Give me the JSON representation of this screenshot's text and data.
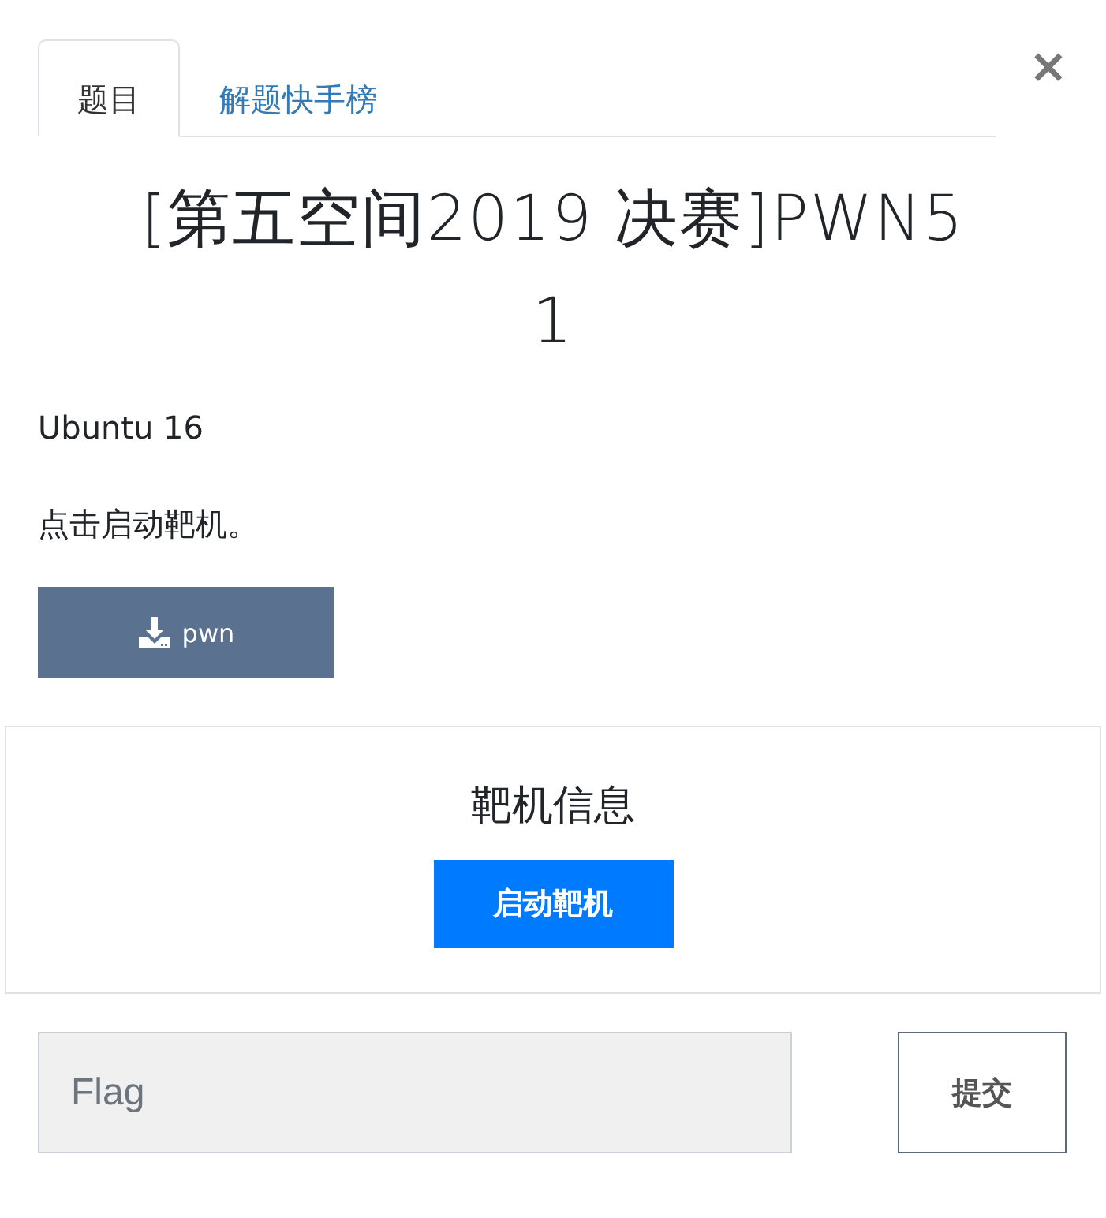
{
  "close": "×",
  "tabs": [
    {
      "label": "题目",
      "selected": true
    },
    {
      "label": "解题快手榜",
      "selected": false
    }
  ],
  "challenge": {
    "title": "[第五空间2019 决赛]PWN5",
    "value": "1",
    "description": [
      "Ubuntu 16",
      "点击启动靶机。"
    ],
    "files": [
      "pwn"
    ]
  },
  "instance": {
    "heading": "靶机信息",
    "button": "启动靶机"
  },
  "flag": {
    "placeholder": "Flag",
    "submit": "提交"
  }
}
